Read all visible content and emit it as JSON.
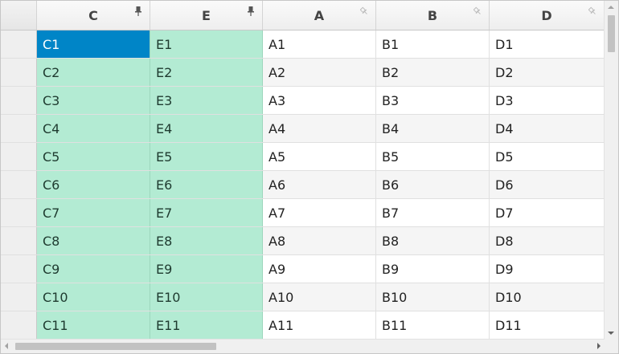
{
  "columns": [
    {
      "label": "C",
      "pinned": true
    },
    {
      "label": "E",
      "pinned": true
    },
    {
      "label": "A",
      "pinned": false
    },
    {
      "label": "B",
      "pinned": false
    },
    {
      "label": "D",
      "pinned": false
    }
  ],
  "rows": [
    [
      "C1",
      "E1",
      "A1",
      "B1",
      "D1"
    ],
    [
      "C2",
      "E2",
      "A2",
      "B2",
      "D2"
    ],
    [
      "C3",
      "E3",
      "A3",
      "B3",
      "D3"
    ],
    [
      "C4",
      "E4",
      "A4",
      "B4",
      "D4"
    ],
    [
      "C5",
      "E5",
      "A5",
      "B5",
      "D5"
    ],
    [
      "C6",
      "E6",
      "A6",
      "B6",
      "D6"
    ],
    [
      "C7",
      "E7",
      "A7",
      "B7",
      "D7"
    ],
    [
      "C8",
      "E8",
      "A8",
      "B8",
      "D8"
    ],
    [
      "C9",
      "E9",
      "A9",
      "B9",
      "D9"
    ],
    [
      "C10",
      "E10",
      "A10",
      "B10",
      "D10"
    ],
    [
      "C11",
      "E11",
      "A11",
      "B11",
      "D11"
    ]
  ],
  "selected_cell": "C1",
  "colors": {
    "frozen_bg": "#b3ebd3",
    "selection_bg": "#0085c7",
    "pin_active": "#555555",
    "pin_inactive": "#bdbdbd"
  },
  "icons": {
    "pinned": "pin-icon",
    "unpinned": "pin-outline-icon"
  }
}
